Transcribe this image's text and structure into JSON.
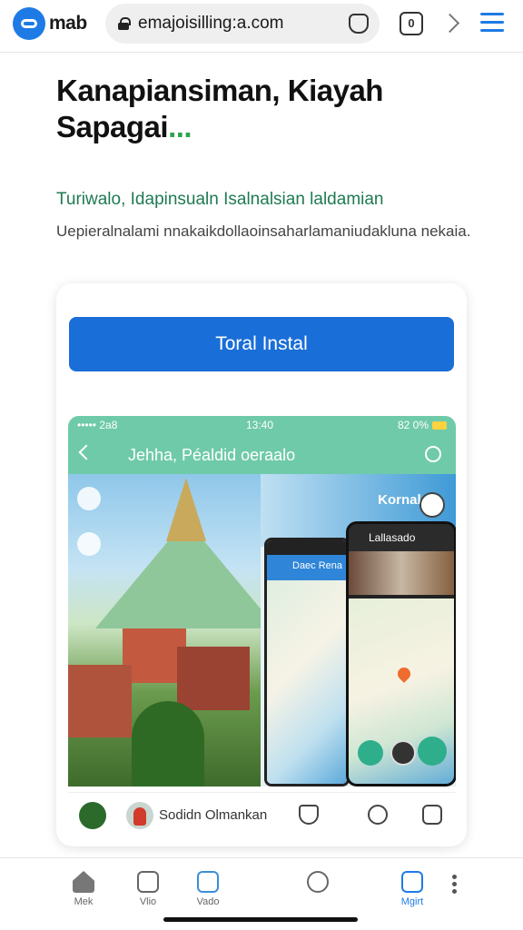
{
  "browser": {
    "logo_text": "mab",
    "url": "emajoisilling:a.com",
    "tabs_count": "0"
  },
  "hero": {
    "headline": "Kanapiansiman, Kiayah Sapagai",
    "headline_suffix": "...",
    "subheading": "Turiwalo, Idapinsualn Isalnalsian laldamian",
    "description": "Uepieralnalami nnakaikdollaoinsaharlamaniudakluna nekaia."
  },
  "card": {
    "install_label": "Toral Instal",
    "preview": {
      "status_left": "••••• 2a8",
      "status_center": "13:40",
      "status_right": "82 0%",
      "nav_title": "Jehha, Péaldid oeraalo",
      "region_label": "Kornala",
      "phone1_header": "Daec Rena",
      "phone2_header": "Lallasado"
    },
    "footer_label": "Sodidn Olmankan"
  },
  "bottom_nav": {
    "items": [
      "Mek",
      "Vlio",
      "Vado",
      "",
      "Mgirt"
    ]
  },
  "colors": {
    "accent": "#1e7be6",
    "install_button": "#1a6ed8",
    "preview_header": "#6fcaa9",
    "subheading": "#1f7a53"
  }
}
